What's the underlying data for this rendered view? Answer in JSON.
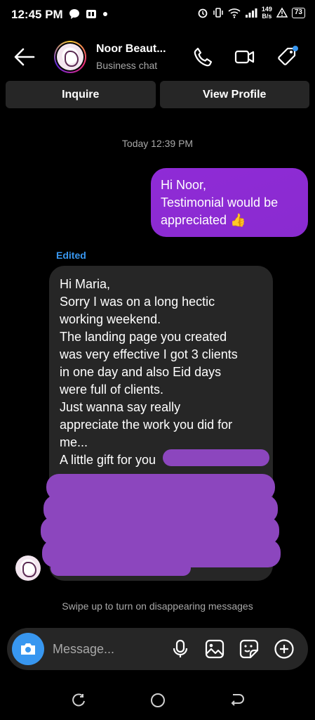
{
  "status_bar": {
    "time": "12:45 PM",
    "net_speed_value": "149",
    "net_speed_unit": "B/s",
    "battery": "73"
  },
  "header": {
    "contact_name": "Noor Beaut...",
    "subtitle": "Business chat"
  },
  "actions": {
    "inquire_label": "Inquire",
    "view_profile_label": "View Profile"
  },
  "conversation": {
    "timestamp": "Today 12:39 PM",
    "outgoing": {
      "lines": [
        "Hi Noor,",
        "Testimonial would be",
        "appreciated 👍"
      ]
    },
    "edited_label": "Edited",
    "incoming": {
      "lines": [
        "Hi Maria,",
        "Sorry I was on a long hectic",
        "working weekend.",
        "The landing page you created",
        "was very effective I got 3 clients",
        "in one day and also Eid days",
        "were full of clients.",
        "Just wanna say really",
        "appreciate the work you did for",
        "me...",
        "A little gift for you"
      ]
    },
    "disappearing_hint": "Swipe up to turn on disappearing messages"
  },
  "composer": {
    "placeholder": "Message..."
  },
  "icons": {
    "accent": "#3897f0",
    "bubble_out": "#8f2bd6",
    "redaction": "#8c46be",
    "list": [
      "back-arrow-icon",
      "phone-icon",
      "video-camera-icon",
      "tag-icon",
      "camera-icon",
      "microphone-icon",
      "gallery-icon",
      "sticker-icon",
      "plus-icon"
    ]
  }
}
